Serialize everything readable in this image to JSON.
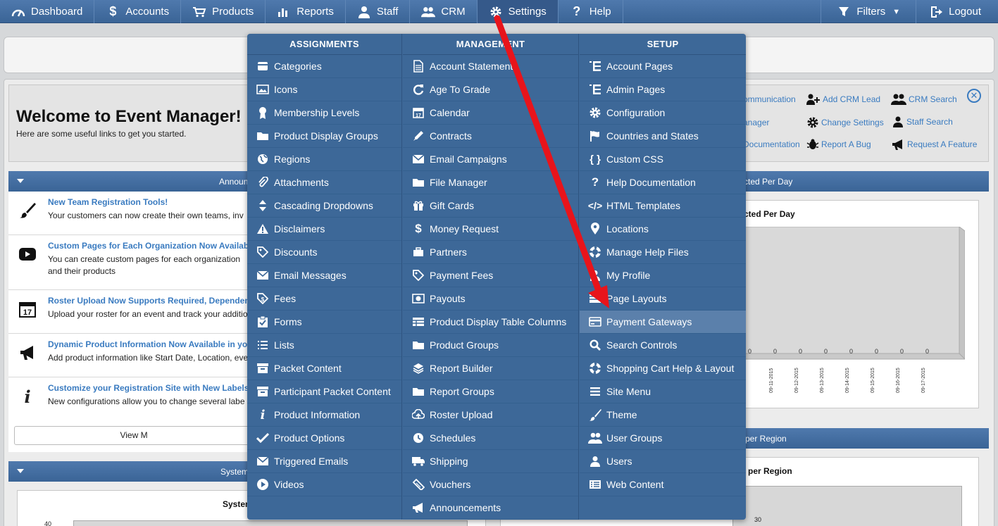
{
  "nav": {
    "items": [
      {
        "label": "Dashboard",
        "icon": "dashboard-icon"
      },
      {
        "label": "Accounts",
        "icon": "dollar-icon"
      },
      {
        "label": "Products",
        "icon": "cart-icon"
      },
      {
        "label": "Reports",
        "icon": "bar-chart-icon"
      },
      {
        "label": "Staff",
        "icon": "user-icon"
      },
      {
        "label": "CRM",
        "icon": "users-icon"
      },
      {
        "label": "Settings",
        "icon": "gear-icon"
      },
      {
        "label": "Help",
        "icon": "question-icon"
      }
    ],
    "filters": "Filters",
    "logout": "Logout"
  },
  "welcome": {
    "title": "Welcome to Event Manager!",
    "subtitle": "Here are some useful links to get you started."
  },
  "quick_links": {
    "communication": "ommunication",
    "add_crm_lead": "Add CRM Lead",
    "crm_search": "CRM Search",
    "manager": "anager",
    "change_settings": "Change Settings",
    "staff_search": "Staff Search",
    "documentation": "Documentation",
    "report_bug": "Report A Bug",
    "request_feature": "Request A Feature"
  },
  "panels": {
    "announcements": "Announ",
    "collected_per_day": "cted Per Day",
    "collected_chart_title": "cted Per Day",
    "per_region": "per Region",
    "per_region_chart_title": "per Region",
    "system": "System",
    "system_chart_title": "System",
    "view_more": "View M",
    "y_tick": "40",
    "region_value": "30"
  },
  "announcements": [
    {
      "title": "New Team Registration Tools!",
      "text": "Your customers can now create their own teams, inv",
      "icon": "brush-icon"
    },
    {
      "title": "Custom Pages for Each Organization Now Availabl",
      "text": "You can create custom pages for each organization and their products",
      "icon": "youtube-icon"
    },
    {
      "title": "Roster Upload Now Supports Required, Dependent",
      "text": "Upload your roster for an event and track your additio",
      "icon": "calendar-17-icon"
    },
    {
      "title": "Dynamic Product Information Now Available in you",
      "text": "Add product information like Start Date, Location, eve",
      "icon": "megaphone-icon"
    },
    {
      "title": "Customize your Registration Site with New Labels",
      "text": "New configurations allow you to change several labe",
      "icon": "info-icon"
    }
  ],
  "chart_dates": [
    "09-11-2015",
    "09-12-2015",
    "09-13-2015",
    "09-14-2015",
    "09-15-2015",
    "09-16-2015",
    "09-17-2015"
  ],
  "chart_zero_values": [
    "0",
    "0",
    "0",
    "0",
    "0",
    "0",
    "0",
    "0"
  ],
  "menu": {
    "assignments": {
      "header": "ASSIGNMENTS",
      "items": [
        {
          "label": "Categories",
          "icon": "categories-icon"
        },
        {
          "label": "Icons",
          "icon": "image-icon"
        },
        {
          "label": "Membership Levels",
          "icon": "ribbon-icon"
        },
        {
          "label": "Product Display Groups",
          "icon": "folder-icon"
        },
        {
          "label": "Regions",
          "icon": "globe-icon"
        },
        {
          "label": "Attachments",
          "icon": "paperclip-icon"
        },
        {
          "label": "Cascading Dropdowns",
          "icon": "sort-icon"
        },
        {
          "label": "Disclaimers",
          "icon": "warning-icon"
        },
        {
          "label": "Discounts",
          "icon": "tag-icon"
        },
        {
          "label": "Email Messages",
          "icon": "envelope-icon"
        },
        {
          "label": "Fees",
          "icon": "fee-icon"
        },
        {
          "label": "Forms",
          "icon": "clipboard-icon"
        },
        {
          "label": "Lists",
          "icon": "list-icon"
        },
        {
          "label": "Packet Content",
          "icon": "box-icon"
        },
        {
          "label": "Participant Packet Content",
          "icon": "box-icon"
        },
        {
          "label": "Product Information",
          "icon": "info-icon"
        },
        {
          "label": "Product Options",
          "icon": "check-icon"
        },
        {
          "label": "Triggered Emails",
          "icon": "envelope-icon"
        },
        {
          "label": "Videos",
          "icon": "play-icon"
        }
      ]
    },
    "management": {
      "header": "MANAGEMENT",
      "items": [
        {
          "label": "Account Statement",
          "icon": "document-icon"
        },
        {
          "label": "Age To Grade",
          "icon": "refresh-icon"
        },
        {
          "label": "Calendar",
          "icon": "calendar-icon"
        },
        {
          "label": "Contracts",
          "icon": "pen-icon"
        },
        {
          "label": "Email Campaigns",
          "icon": "envelope-icon"
        },
        {
          "label": "File Manager",
          "icon": "folder-icon"
        },
        {
          "label": "Gift Cards",
          "icon": "gift-icon"
        },
        {
          "label": "Money Request",
          "icon": "dollar-icon"
        },
        {
          "label": "Partners",
          "icon": "briefcase-icon"
        },
        {
          "label": "Payment Fees",
          "icon": "tag-icon"
        },
        {
          "label": "Payouts",
          "icon": "money-icon"
        },
        {
          "label": "Product Display Table Columns",
          "icon": "table-icon"
        },
        {
          "label": "Product Groups",
          "icon": "folder-icon"
        },
        {
          "label": "Report Builder",
          "icon": "layers-icon"
        },
        {
          "label": "Report Groups",
          "icon": "folder-icon"
        },
        {
          "label": "Roster Upload",
          "icon": "upload-icon"
        },
        {
          "label": "Schedules",
          "icon": "clock-icon"
        },
        {
          "label": "Shipping",
          "icon": "truck-icon"
        },
        {
          "label": "Vouchers",
          "icon": "ticket-icon"
        },
        {
          "label": "Announcements",
          "icon": "megaphone-icon"
        }
      ]
    },
    "setup": {
      "header": "SETUP",
      "items": [
        {
          "label": "Account Pages",
          "icon": "list-indent-icon"
        },
        {
          "label": "Admin Pages",
          "icon": "list-indent-icon"
        },
        {
          "label": "Configuration",
          "icon": "gear-icon"
        },
        {
          "label": "Countries and States",
          "icon": "flag-icon"
        },
        {
          "label": "Custom CSS",
          "icon": "braces-icon"
        },
        {
          "label": "Help Documentation",
          "icon": "question-icon"
        },
        {
          "label": "HTML Templates",
          "icon": "code-icon"
        },
        {
          "label": "Locations",
          "icon": "map-pin-icon"
        },
        {
          "label": "Manage Help Files",
          "icon": "lifebuoy-icon"
        },
        {
          "label": "My Profile",
          "icon": "user-icon"
        },
        {
          "label": "Page Layouts",
          "icon": "layout-icon"
        },
        {
          "label": "Payment Gateways",
          "icon": "credit-card-icon"
        },
        {
          "label": "Search Controls",
          "icon": "search-icon"
        },
        {
          "label": "Shopping Cart Help & Layout",
          "icon": "lifebuoy-icon"
        },
        {
          "label": "Site Menu",
          "icon": "menu-icon"
        },
        {
          "label": "Theme",
          "icon": "brush-icon"
        },
        {
          "label": "User Groups",
          "icon": "users-icon"
        },
        {
          "label": "Users",
          "icon": "user-icon"
        },
        {
          "label": "Web Content",
          "icon": "web-content-icon"
        }
      ]
    },
    "highlighted": "Payment Gateways"
  },
  "colors": {
    "nav_bg": "#3f6a9c",
    "menu_bg": "#3d6898",
    "highlight": "#5b80ab",
    "link": "#3a7bc0",
    "arrow": "#e8141b"
  }
}
